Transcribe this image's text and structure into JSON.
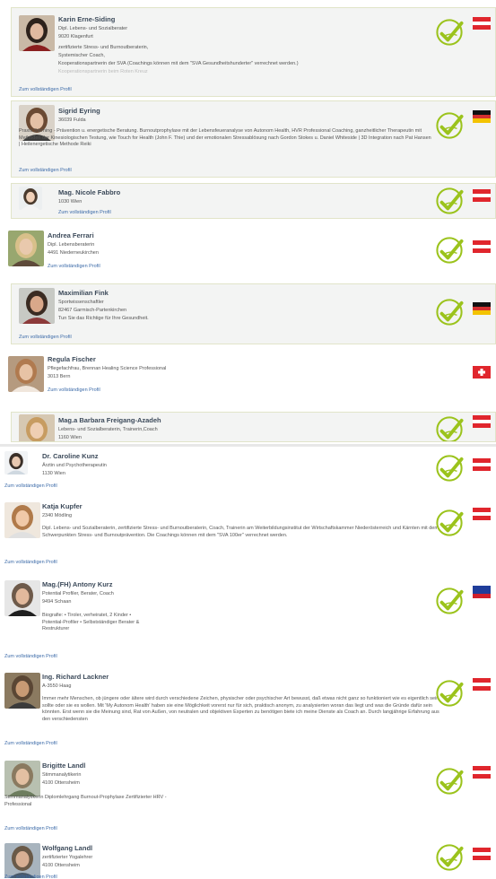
{
  "brand": {
    "accent": "#9bc31c",
    "link": "#3b6aa8",
    "name": "#3c4a5a",
    "card_bg": "#f3f4f3"
  },
  "profiles": [
    {
      "name": "Karin Erne-Siding",
      "lines": [
        "Dipl. Lebens- und Sozialberater",
        "9020 Klagenfurt",
        "zertifizierte Stress- und Burnoutberaterin,",
        "Systemischer Coach,",
        "Kooperationspartnerin der SVA (Coachings können mit dem \"SVA Gesundheitshunderter\" verrechnet werden.)",
        "Kooperationspartnerin beim Roten Kreuz"
      ],
      "link": "Zum vollständigen Profil",
      "country": "austria",
      "badge": "checkmark-badge-icon"
    },
    {
      "name": "Sigrid Eyring",
      "lines": [
        "36039 Fulda"
      ],
      "text": "Praxis Sterning - Prävention u. energetische Beratung. Burnoutprophylaxe mit der Lebensfeueranalyse von Autonom Health, HVR Professional Coaching, ganzheitlicher Therapeutin mit Methoden der Kinesiologischen Testung, wie Touch for Health (John F. Thie) und der emotionalen Stressablösung nach Gordon Stokes u. Daniel Whiteside | 3D Integration nach Pat Hansen | Heilenergetische Methode Reiki",
      "link": "Zum vollständigen Profil",
      "country": "germany",
      "badge": "checkmark-badge-icon"
    },
    {
      "name": "Mag. Nicole Fabbro",
      "lines": [
        "1030 Wien"
      ],
      "link": "Zum vollständigen Profil",
      "country": "austria",
      "badge": "checkmark-badge-icon"
    },
    {
      "name": "Andrea Ferrari",
      "lines": [
        "Dipl. Lebensberaterin",
        "4491 Niederneukirchen"
      ],
      "link": "Zum vollständigen Profil",
      "country": "austria",
      "badge": "checkmark-badge-icon"
    },
    {
      "name": "Maximilian Fink",
      "lines": [
        "Sportwissenschaftler",
        "82467 Garmisch-Partenkirchen",
        "Tun Sie das Richtige für Ihre Gesundheit."
      ],
      "link": "Zum vollständigen Profil",
      "country": "germany",
      "badge": "checkmark-badge-icon"
    },
    {
      "name": "Regula Fischer",
      "lines": [
        "Pflegefachfrau, Brennan Healing Science Professional",
        "3013 Bern"
      ],
      "link": "Zum vollständigen Profil",
      "country": "switzerland",
      "badge": ""
    },
    {
      "name": "Mag.a Barbara Freigang-Azadeh",
      "lines": [
        "Lebens- und Sozialberaterin, Trainerin,Coach",
        "1160 Wien"
      ],
      "link": "",
      "country": "austria",
      "badge": "checkmark-badge-icon"
    },
    {
      "name": "Dr. Caroline Kunz",
      "lines": [
        "Ärztin und Psychotherapeutin",
        "1130 Wien"
      ],
      "link": "Zum vollständigen Profil",
      "country": "austria",
      "badge": "checkmark-badge-icon"
    },
    {
      "name": "Katja Kupfer",
      "lines": [
        "2340 Mödling"
      ],
      "text": "Dipl. Lebens- und Sozialberaterin, zertifizierte Stress- und Burnoutberaterin, Coach, Trainerin am Weiterbildungsinstitut der Wirtschaftskammer Niederösterreich und Kärnten mit dem Schwerpunkten Stress- und Burnoutprävention. Die Coachings können mit dem \"SVA 100er\" verrechnet werden.",
      "link": "Zum vollständigen Profil",
      "country": "austria",
      "badge": "checkmark-badge-icon"
    },
    {
      "name": "Mag.(FH) Antony Kurz",
      "lines": [
        "Potential Profiler, Berater, Coach",
        "9494 Schaan"
      ],
      "text": "Biografie: • Tiroler, verheiratet, 2 Kinder • Potential-Profiler • Selbstständiger Berater & Restrukturer",
      "link": "Zum vollständigen Profil",
      "country": "liechtenstein",
      "badge": "checkmark-badge-icon"
    },
    {
      "name": "Ing. Richard Lackner",
      "lines": [
        "A-3550 Haag"
      ],
      "text": "Immer mehr Menschen, ob jüngere oder ältere wird durch verschiedene Zeichen, physischer oder psychischer Art bewusst, daß etwas nicht ganz so funktioniert wie es eigentlich sein sollte oder sie es wollen. Mit 'My Autonom Health' haben sie eine Möglichkeit vorerst nur für sich, praktisch anonym, zu analysierten woran das liegt und was die Gründe dafür sein könnten. Erst wenn sie die Meinung sind, Rat von Außen, von neutralen und objektiven Experten zu benötigen biete ich meine Dienste als Coach an. Durch langjährige Erfahrung aus den verschiedensten",
      "link": "Zum vollständigen Profil",
      "country": "austria",
      "badge": "checkmark-badge-icon"
    },
    {
      "name": "Brigitte Landl",
      "lines": [
        "Stimmanalytikerin",
        "4100 Ottensheim"
      ],
      "text": "Stimmanalytikerin Diplomlehrgang Burnout-Prophylaxe Zertifizierter HRV - Professional",
      "link": "Zum vollständigen Profil",
      "country": "austria",
      "badge": "checkmark-badge-icon"
    },
    {
      "name": "Wolfgang Landl",
      "lines": [
        "zertifizierter Yogalehrer",
        "4100 Ottensheim"
      ],
      "link": "Zum vollständigen Profil",
      "country": "austria",
      "badge": "checkmark-badge-icon"
    }
  ]
}
